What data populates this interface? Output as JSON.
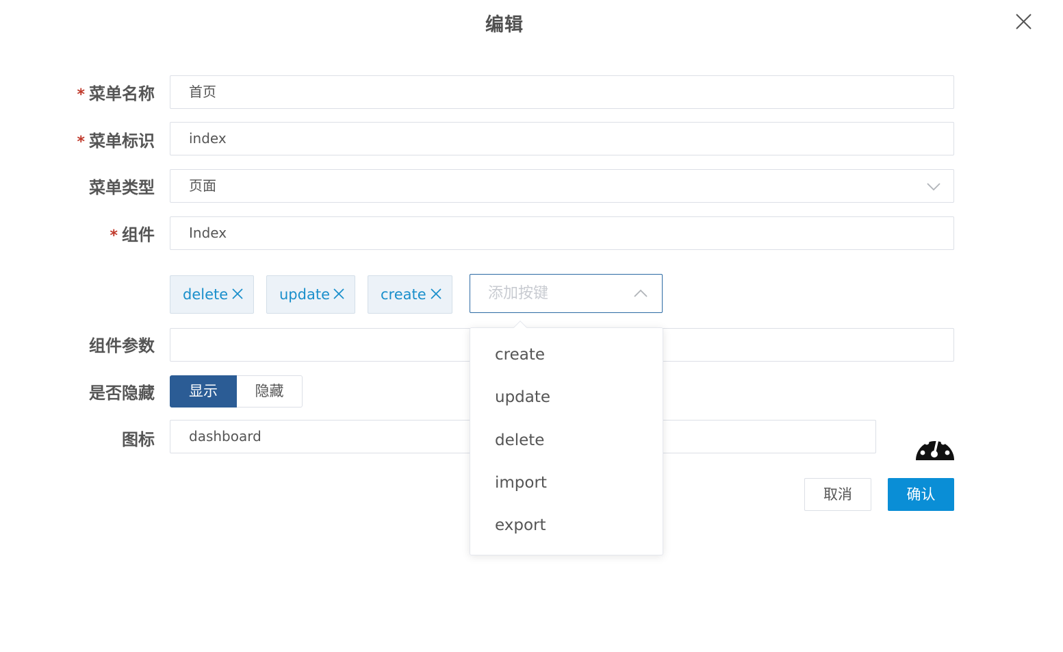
{
  "dialog": {
    "title": "编辑"
  },
  "form": {
    "menu_name": {
      "label": "菜单名称",
      "required": true,
      "value": "首页"
    },
    "menu_key": {
      "label": "菜单标识",
      "required": true,
      "value": "index"
    },
    "menu_type": {
      "label": "菜单类型",
      "required": false,
      "value": "页面"
    },
    "component": {
      "label": "组件",
      "required": true,
      "value": "Index"
    },
    "buttons": {
      "tags": [
        "delete",
        "update",
        "create"
      ],
      "placeholder": "添加按键",
      "options": [
        "create",
        "update",
        "delete",
        "import",
        "export"
      ]
    },
    "component_params": {
      "label": "组件参数",
      "value": ""
    },
    "hidden": {
      "label": "是否隐藏",
      "options": [
        "显示",
        "隐藏"
      ],
      "selected": "显示"
    },
    "icon": {
      "label": "图标",
      "value": "dashboard",
      "preview_icon": "dashboard-icon"
    }
  },
  "actions": {
    "cancel": "取消",
    "confirm": "确认"
  },
  "colors": {
    "primary": "#0a8ed6",
    "radio_active": "#2b5c95",
    "tag_text": "#1a8fcb",
    "required": "#c0392b"
  }
}
